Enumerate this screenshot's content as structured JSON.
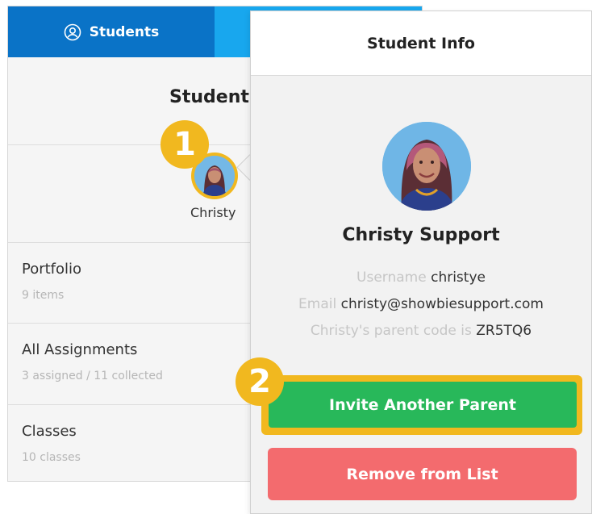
{
  "tabs": {
    "students_label": "Students",
    "students_icon": "person-circle-icon"
  },
  "panel": {
    "title": "Student",
    "avatar_name": "Christy",
    "rows": [
      {
        "title": "Portfolio",
        "subtitle": "9 items"
      },
      {
        "title": "All Assignments",
        "subtitle": "3 assigned / 11 collected"
      },
      {
        "title": "Classes",
        "subtitle": "10 classes"
      }
    ]
  },
  "callouts": {
    "step1": "1",
    "step2": "2"
  },
  "popover": {
    "title": "Student Info",
    "name": "Christy Support",
    "username_label": "Username",
    "username": "christye",
    "email_label": "Email",
    "email": "christy@showbiesupport.com",
    "parent_code_label": "Christy's parent code is",
    "parent_code": "ZR5TQ6",
    "invite_label": "Invite Another Parent",
    "remove_label": "Remove from List"
  },
  "colors": {
    "tab_active": "#0a73c7",
    "tab_inactive": "#18a7ee",
    "highlight": "#f1b81f",
    "invite_green": "#28b85a",
    "remove_red": "#f36b6e"
  }
}
